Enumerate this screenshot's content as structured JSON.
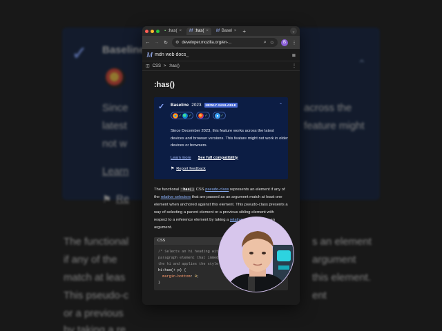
{
  "background": {
    "baseline": "Baseline",
    "line1_left": "Since",
    "line1_right": "across the",
    "line2_left": "latest",
    "line2_right": "feature might",
    "line3_left": "not w",
    "learn": "Learn",
    "report": "Re",
    "p1_left": "The functional",
    "p1_right": "s an element",
    "p2_left": "if any of the",
    "p2_right": "argument",
    "p3_left": "match at leas",
    "p3_right": "this element.",
    "p4_left": "This pseudo-c",
    "p4_right": "ent",
    "p5_left": "or a previous",
    "p6_left": "by taking a re"
  },
  "browser": {
    "tabs": [
      {
        "label": ":has(",
        "active": false
      },
      {
        "label": ":has(",
        "active": true
      },
      {
        "label": "Basel",
        "active": false
      }
    ],
    "url": "developer.mozilla.org/en-...",
    "profile_initial": "B"
  },
  "mdn": {
    "logo": "M",
    "brand": "mdn web docs_",
    "breadcrumb": [
      "CSS",
      ":has()"
    ]
  },
  "page": {
    "title": ":has()",
    "baseline": {
      "label": "Baseline",
      "year": "2023",
      "badge": "NEWLY AVAILABLE",
      "description": "Since December 2023, this feature works across the latest devices and browser versions. This feature might not work in older devices or browsers.",
      "learn_more": "Learn more",
      "compat": "See full compatibility",
      "report": "Report feedback"
    },
    "para": {
      "p1": "The functional ",
      "code": ":has()",
      "p2": " CSS ",
      "link1": "pseudo-class",
      "p3": " represents an element if any of the ",
      "link2": "relative selectors",
      "p4": " that are passed as an argument match at least one element when anchored against this element. This pseudo-class presents a way of selecting a parent element or a previous sibling element with respect to a reference element by taking a ",
      "link3": "relative selector list",
      "p5": " as an argument."
    },
    "code": {
      "lang": "CSS",
      "line1": "/* Selects an h1 heading with a",
      "line2": "paragraph element that immediately follows",
      "line3": "the h1 and applies the style to h1 */",
      "line4_sel": "h1:has(+ p)",
      "line4_brace": " {",
      "line5_prop": "  margin-bottom",
      "line5_colon": ": ",
      "line5_val": "0",
      "line5_end": ";",
      "line6": "}"
    }
  },
  "colors": {
    "baseline_bg": "#0c1d44",
    "badge": "#4b6bd4",
    "link": "#8cb4ff",
    "camera_bg": "#d7c6ec"
  }
}
